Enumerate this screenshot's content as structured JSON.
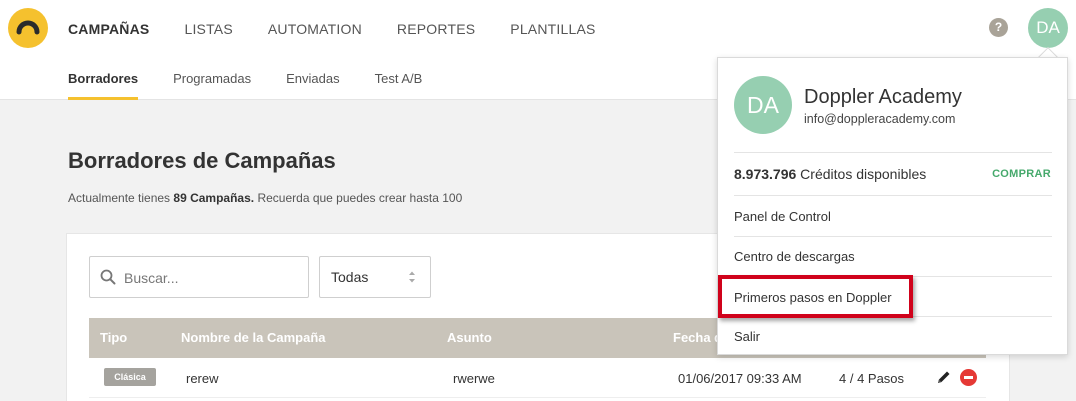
{
  "header": {
    "nav": [
      {
        "label": "CAMPAÑAS",
        "active": true
      },
      {
        "label": "LISTAS"
      },
      {
        "label": "AUTOMATION"
      },
      {
        "label": "REPORTES"
      },
      {
        "label": "PLANTILLAS"
      }
    ],
    "help_label": "?",
    "avatar_initials": "DA"
  },
  "subnav": [
    {
      "label": "Borradores",
      "active": true
    },
    {
      "label": "Programadas"
    },
    {
      "label": "Enviadas"
    },
    {
      "label": "Test A/B"
    }
  ],
  "main": {
    "title": "Borradores de Campañas",
    "subtitle_prefix": "Actualmente tienes ",
    "subtitle_count": "89 Campañas.",
    "subtitle_suffix": " Recuerda que puedes crear hasta 100",
    "search_placeholder": "Buscar...",
    "filter_value": "Todas",
    "table": {
      "headers": [
        "Tipo",
        "Nombre de la Campaña",
        "Asunto",
        "Fecha d"
      ],
      "rows": [
        {
          "tipo": "Clásica",
          "nombre": "rerew",
          "asunto": "rwerwe",
          "fecha": "01/06/2017 09:33 AM",
          "pasos": "4 / 4 Pasos"
        }
      ]
    }
  },
  "dropdown": {
    "initials": "DA",
    "name": "Doppler Academy",
    "email": "info@doppleracademy.com",
    "credits_value": "8.973.796",
    "credits_label": " Créditos disponibles",
    "buy_label": "COMPRAR",
    "items": [
      "Panel de Control",
      "Centro de descargas",
      "Primeros pasos en Doppler",
      "Salir"
    ]
  },
  "colors": {
    "brand": "#f5c12e",
    "avatar": "#96cfb1",
    "buy": "#46a96c",
    "highlight": "#d0021b",
    "table_header": "#c9c4ba"
  }
}
